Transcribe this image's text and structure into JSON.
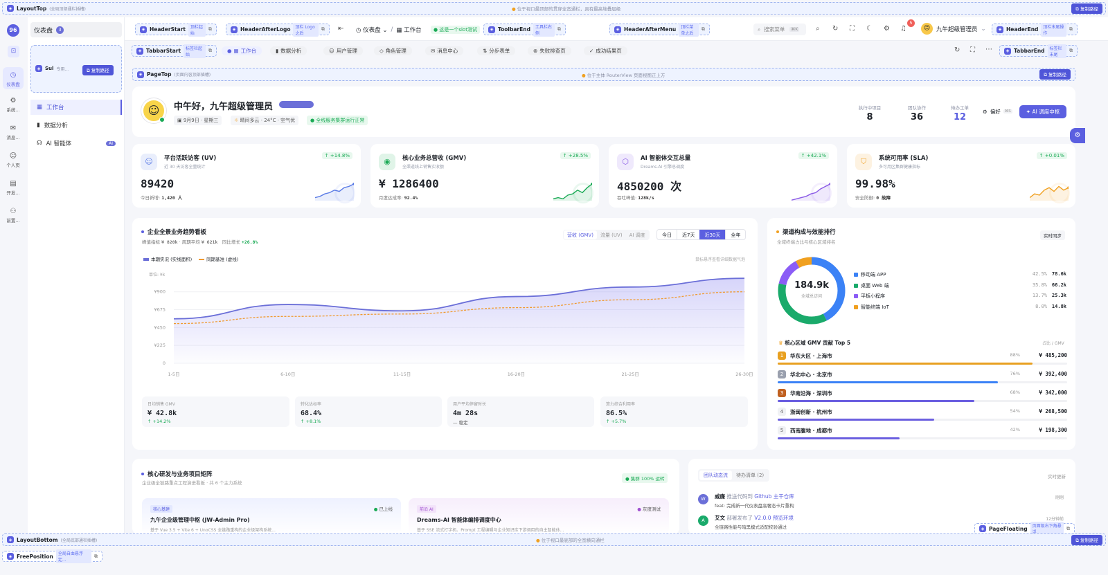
{
  "layout_top": {
    "title": "LayoutTop",
    "sub": "(全局顶部通栏插槽)",
    "note": "位于视口最顶部的贯穿全宽通栏，具有最高堆叠层级",
    "copy": "复制路径"
  },
  "layout_bottom": {
    "title": "LayoutBottom",
    "sub": "(全局底部通栏插槽)",
    "note": "位于视口最底部的全宽横向通栏",
    "copy": "复制路径"
  },
  "free_position": {
    "title": "FreePosition",
    "tag": "全局自由悬浮定..."
  },
  "page_floating": {
    "title": "PageFloating",
    "tag": "页面级右下角悬浮"
  },
  "sidebar": {
    "title": "仪表盘",
    "count": "3",
    "slot_title": "Sul",
    "slot_sub": "专用...",
    "slot_copy": "复制路径",
    "rail": [
      {
        "label": "仪表盘",
        "icon": "◷"
      },
      {
        "label": "系统...",
        "icon": "⚙"
      },
      {
        "label": "消息...",
        "icon": "✉"
      },
      {
        "label": "个人页",
        "icon": "☺"
      },
      {
        "label": "开发...",
        "icon": "▤"
      },
      {
        "label": "前置...",
        "icon": "⚇"
      }
    ],
    "menu": [
      {
        "label": "工作台",
        "icon": "▦"
      },
      {
        "label": "数据分析",
        "icon": "▮"
      },
      {
        "label": "AI 智能体",
        "icon": "☊",
        "badge": "AI"
      }
    ]
  },
  "header": {
    "header_start": {
      "title": "HeaderStart",
      "tag": "顶栏起始"
    },
    "header_after_logo": {
      "title": "HeaderAfterLogo",
      "tag": "顶栏 Logo 之后"
    },
    "breadcrumb_root": "仪表盘",
    "breadcrumb_current": "工作台",
    "slot_test": "这是一个slot测试",
    "toolbar_end": {
      "title": "ToolbarEnd",
      "tag": "工具栏右侧"
    },
    "header_after_menu": {
      "title": "HeaderAfterMenu",
      "tag": "顶栏菜单之后"
    },
    "search_placeholder": "搜索菜单",
    "search_shortcut": "⌘K",
    "notification_count": "5",
    "user_name": "九午超级管理员",
    "header_end": {
      "title": "HeaderEnd",
      "tag": "顶栏末尾操作"
    }
  },
  "tabbar": {
    "start": {
      "title": "TabbarStart",
      "tag": "标签栏起始"
    },
    "end": {
      "title": "TabbarEnd",
      "tag": "标签栏末尾"
    },
    "tabs": [
      {
        "label": "工作台",
        "icon": "▦"
      },
      {
        "label": "数据分析",
        "icon": "▮"
      },
      {
        "label": "用户管理",
        "icon": "☺"
      },
      {
        "label": "角色管理",
        "icon": "◇"
      },
      {
        "label": "消息中心",
        "icon": "✉"
      },
      {
        "label": "分步表单",
        "icon": "⇅"
      },
      {
        "label": "失败排查页",
        "icon": "⊗"
      },
      {
        "label": "成功结果页",
        "icon": "✓"
      }
    ]
  },
  "page_top": {
    "title": "PageTop",
    "sub": "(页面内容顶部插槽)",
    "note": "位于主体 RouterView 页面视图正上方",
    "copy": "复制路径"
  },
  "welcome": {
    "greeting": "中午好，九午超级管理员",
    "date": "9月9日 · 星期三",
    "weather": "晴间多云 · 24°C · 空气优",
    "status": "全线服务集群运行正常",
    "stats": [
      {
        "label": "执行中项目",
        "value": "8"
      },
      {
        "label": "团队协作",
        "value": "36"
      },
      {
        "label": "待办工单",
        "value": "12"
      }
    ],
    "pref": "偏好",
    "pref_shortcut": "⌘S",
    "ai_button": "AI 调度中枢"
  },
  "metrics": [
    {
      "title": "平台活跃访客 (UV)",
      "sub": "近 30 天访客全量统计",
      "change": "+14.8%",
      "value": "89420",
      "foot_label": "今日新增:",
      "foot_value": "1,420 人",
      "color": "#5b7ce6"
    },
    {
      "title": "核心业务总营收 (GMV)",
      "sub": "全渠道线上销售实收额",
      "change": "+28.5%",
      "value": "¥ 1286400",
      "foot_label": "月度达成率:",
      "foot_value": "92.4%",
      "color": "#1aaa55"
    },
    {
      "title": "AI 智能体交互总量",
      "sub": "Dreams-AI 引擎总调度",
      "change": "+42.1%",
      "value": "4850200 次",
      "foot_label": "吞吐峰值:",
      "foot_value": "128k/s",
      "color": "#8a5ae6"
    },
    {
      "title": "系统可用率 (SLA)",
      "sub": "多可用区集群健康指标",
      "change": "+0.01%",
      "value": "99.98%",
      "foot_label": "安全防御:",
      "foot_value": "0 故障",
      "color": "#f0a020"
    }
  ],
  "trend": {
    "title": "企业全景业务趋势看板",
    "sub_label1": "峰值指标",
    "sub_val1": "¥ 820k",
    "sub_label2": "周期平均",
    "sub_val2": "¥ 621k",
    "sub_label3": "同比增长",
    "sub_val3": "+26.8%",
    "metric_tabs": [
      "营收 (GMV)",
      "流量 (UV)",
      "AI 调度"
    ],
    "range_tabs": [
      "今日",
      "近7天",
      "近30天",
      "全年"
    ],
    "legend_actual": "本期实况 (实线面积)",
    "legend_base": "同期基准 (虚线)",
    "hint": "鼠标悬浮查看详细数据气泡",
    "unit": "单位: ¥k",
    "kpis": [
      {
        "label": "日均销售 GMV",
        "value": "¥ 42.8k",
        "delta": "+14.2%"
      },
      {
        "label": "转化达标率",
        "value": "68.4%",
        "delta": "+8.1%"
      },
      {
        "label": "用户平均停留时长",
        "value": "4m 28s",
        "delta": "稳定"
      },
      {
        "label": "算力综合利用率",
        "value": "86.5%",
        "delta": "+5.7%"
      }
    ]
  },
  "chart_data": {
    "type": "area",
    "x": [
      "1-5日",
      "6-10日",
      "11-15日",
      "16-20日",
      "21-25日",
      "26-30日"
    ],
    "y_ticks": [
      "0",
      "¥225",
      "¥450",
      "¥675",
      "¥900"
    ],
    "ylim": [
      0,
      1150
    ],
    "ylabel": "单位: ¥k",
    "series": [
      {
        "name": "本期实况 (实线面积)",
        "values": [
          560,
          740,
          660,
          840,
          960,
          1070
        ],
        "color": "#6b6fd8",
        "style": "solid-area"
      },
      {
        "name": "同期基准 (虚线)",
        "values": [
          500,
          590,
          620,
          700,
          800,
          900
        ],
        "color": "#f09a30",
        "style": "dashed"
      }
    ]
  },
  "channels": {
    "title": "渠道构成与效能排行",
    "sub": "全域终端占比与核心区域排名",
    "live": "实时同步",
    "total": "184.9k",
    "total_label": "全域总访问",
    "items": [
      {
        "label": "移动端 APP",
        "pct": "42.5%",
        "value": "78.6k",
        "share": 42.5,
        "color": "#3b82f6"
      },
      {
        "label": "桌面 Web 端",
        "pct": "35.8%",
        "value": "66.2k",
        "share": 35.8,
        "color": "#1aaa6b"
      },
      {
        "label": "平板小程序",
        "pct": "13.7%",
        "value": "25.3k",
        "share": 13.7,
        "color": "#8b5cf6"
      },
      {
        "label": "智能终端 IoT",
        "pct": "8.0%",
        "value": "14.8k",
        "share": 8.0,
        "color": "#f0a020"
      }
    ],
    "rank_title": "核心区域 GMV 贡献 Top 5",
    "rank_unit": "占比 / GMV",
    "ranks": [
      {
        "n": "1",
        "name": "华东大区 · 上海市",
        "pct": "88%",
        "value": "¥ 485,200",
        "share": 88,
        "color": "#e8a020"
      },
      {
        "n": "2",
        "name": "华北中心 · 北京市",
        "pct": "76%",
        "value": "¥ 392,400",
        "share": 76,
        "color": "#3b82f6"
      },
      {
        "n": "3",
        "name": "华南沿海 · 深圳市",
        "pct": "68%",
        "value": "¥ 342,000",
        "share": 68,
        "color": "#6b5fe0"
      },
      {
        "n": "4",
        "name": "浙闽创新 · 杭州市",
        "pct": "54%",
        "value": "¥ 268,500",
        "share": 54,
        "color": "#6b5fe0"
      },
      {
        "n": "5",
        "name": "西南腹地 · 成都市",
        "pct": "42%",
        "value": "¥ 198,300",
        "share": 42,
        "color": "#6b5fe0"
      }
    ]
  },
  "projects": {
    "title": "核心研发与业务项目矩阵",
    "sub": "企业级全链路重点工程演进看板 · 共 6 个主力系统",
    "cluster": "集群 100% 运转",
    "cards": [
      {
        "tag": "核心基建",
        "status": "已上线",
        "name": "九午企业级管理中枢 (JW-Admin Pro)",
        "desc": "基于 Vue 3.5 + Vite 6 + UnoCSS 全链路重构的企业级架构系统..."
      },
      {
        "tag": "前沿 AI",
        "status": "灰度测试",
        "name": "Dreams-AI 智能体编排调度中心",
        "desc": "基于 SSE 流式打字机、Prompt 工程编辑与企业知识库下游调用的自主智能体..."
      }
    ]
  },
  "activity": {
    "tabs": [
      "团队动态流",
      "待办清单 (2)"
    ],
    "more": "实时更新",
    "items": [
      {
        "avatar": "W",
        "name": "威廉",
        "action": "推送代码到",
        "target": "Github 主干仓库",
        "detail": "feat: 完成新一代仪表盘高奢态卡片重构",
        "time": "刚刚"
      },
      {
        "avatar": "A",
        "name": "艾文",
        "action": "部署发布了",
        "target": "V2.0.0 预览环境",
        "detail": "全链路性能与暗黑模式适配校验通过",
        "time": "12分钟前"
      }
    ]
  }
}
